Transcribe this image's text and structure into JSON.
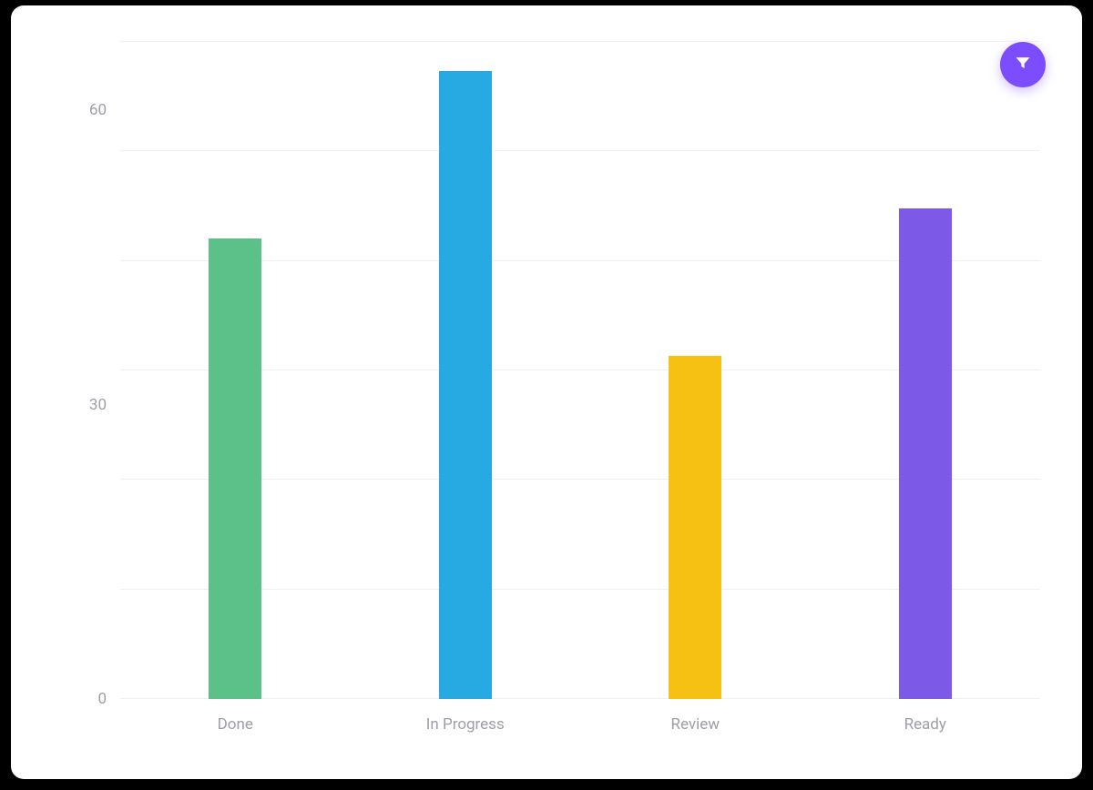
{
  "chart_data": {
    "type": "bar",
    "categories": [
      "Done",
      "In Progress",
      "Review",
      "Ready"
    ],
    "values": [
      47,
      64,
      35,
      50
    ],
    "colors": [
      "#5bc189",
      "#27a9e1",
      "#f6c112",
      "#7c59e6"
    ],
    "y_ticks": [
      0,
      30,
      60
    ],
    "ylim": [
      0,
      67
    ],
    "grid_divisions": 6
  },
  "filter": {
    "icon_name": "filter-icon",
    "color": "#7c4dff"
  }
}
